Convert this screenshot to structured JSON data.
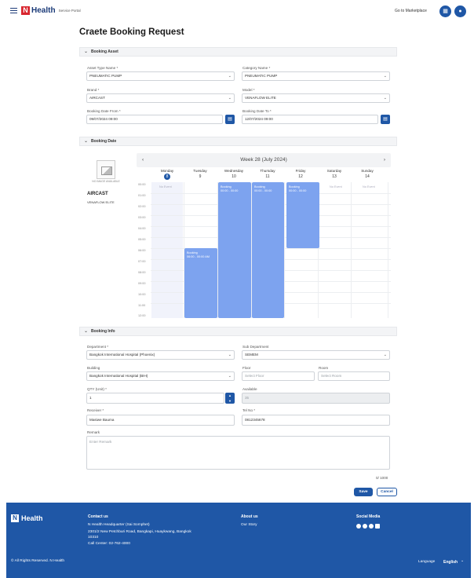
{
  "header": {
    "brand": "Health",
    "brand_sub": "Service Portal",
    "marketplace_link": "Go to Marketplace"
  },
  "page_title": "Craete Booking Request",
  "booking_asset": {
    "section_title": "Booking Asset",
    "asset_type": {
      "label": "Asset Type Name *",
      "value": "PNEUMATIC PUMP"
    },
    "category": {
      "label": "Category Name *",
      "value": "PNEUMATIC PUMP"
    },
    "brand": {
      "label": "Brand *",
      "value": "AIRCAST"
    },
    "model": {
      "label": "Model *",
      "value": "VENAFLOW ELITE"
    },
    "date_from": {
      "label": "Booking Date From *",
      "value": "09/07/2024 09:00"
    },
    "date_to": {
      "label": "Booking Date To *",
      "value": "12/07/2024 09:00"
    }
  },
  "booking_date": {
    "section_title": "Booking Date",
    "no_image": "NO IMAGE AVAILABLE",
    "asset_brand": "AIRCAST",
    "asset_model": "VENAFLOW ELITE",
    "week_label": "Week 28 (July 2024)",
    "days": [
      {
        "name": "Monday",
        "num": "8"
      },
      {
        "name": "Tuesday",
        "num": "9"
      },
      {
        "name": "Wednesday",
        "num": "10"
      },
      {
        "name": "Thursday",
        "num": "11"
      },
      {
        "name": "Friday",
        "num": "12"
      },
      {
        "name": "Saturday",
        "num": "13"
      },
      {
        "name": "Sunday",
        "num": "14"
      }
    ],
    "times": [
      "00:00",
      "01:00",
      "02:00",
      "03:00",
      "04:00",
      "05:00",
      "06:00",
      "07:00",
      "08:00",
      "09:00",
      "10:00",
      "11:00",
      "12:00"
    ],
    "no_event": "No Event",
    "booking_label": "Booking",
    "booking_time": "00:00 - 00:00",
    "booking_time_tue": "06:00 - 00:00 AM"
  },
  "booking_info": {
    "section_title": "Booking Info",
    "department": {
      "label": "Department *",
      "value": "Bangkok International Hospital (Phoenix)"
    },
    "sub_department": {
      "label": "Sub Department",
      "value": "SEMEM"
    },
    "building": {
      "label": "Building",
      "value": "Bangkok International Hospital (BIH)"
    },
    "floor": {
      "label": "Floor",
      "placeholder": "Select Floor"
    },
    "room": {
      "label": "Room",
      "placeholder": "Select Room"
    },
    "qty": {
      "label": "QTY (Unit) *",
      "value": "1"
    },
    "available": {
      "label": "Available",
      "value": "35"
    },
    "receiver": {
      "label": "Receiver *",
      "value": "Masiwe Bauma"
    },
    "tel": {
      "label": "Tel No *",
      "value": "0812345678"
    },
    "remark": {
      "label": "Remark",
      "placeholder": "Enter Remark"
    },
    "char_count": "0/ 1000"
  },
  "actions": {
    "save": "Save",
    "cancel": "Cancel"
  },
  "footer": {
    "brand": "Health",
    "contact_title": "Contact us",
    "contact_name": "N Health Headquarter (Sai Somphet)",
    "contact_addr1": "2301/2 New Petchburi Road, Bangkapi, Huaykwang, Bangkok",
    "contact_addr2": "10310",
    "call_center": "Call Center: 02-762-4000",
    "about_title": "About us",
    "our_story": "Our Story",
    "social_title": "Social Media",
    "copyright": "© All Rights Reserved. N Health",
    "language_label": "Language",
    "language_value": "English"
  },
  "colors": {
    "primary": "#1f57a6",
    "booking": "#7da3ef",
    "logo_red": "#d8262f"
  }
}
